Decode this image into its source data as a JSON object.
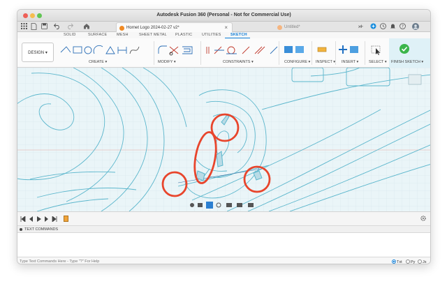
{
  "window": {
    "title": "Autodesk Fusion 360 (Personal - Not for Commercial Use)"
  },
  "tabs": [
    {
      "label": "Hornet Logo 2024-02-27 v2*",
      "active": true
    },
    {
      "label": "Untitled*",
      "active": false
    }
  ],
  "workspace_tabs": [
    "SOLID",
    "SURFACE",
    "MESH",
    "SHEET METAL",
    "PLASTIC",
    "UTILITIES",
    "SKETCH"
  ],
  "active_workspace_tab": "SKETCH",
  "toolbar": {
    "design_label": "DESIGN",
    "groups": {
      "create": "CREATE",
      "modify": "MODIFY",
      "constraints": "CONSTRAINTS",
      "configure": "CONFIGURE",
      "inspect": "INSPECT",
      "insert": "INSERT",
      "select": "SELECT",
      "finish": "FINISH SKETCH"
    },
    "caret": "▾"
  },
  "text_commands": {
    "header": "TEXT COMMANDS",
    "placeholder": "Type Text Commands Here - Type \"?\" For Help",
    "modes": [
      {
        "label": "Txt",
        "selected": true
      },
      {
        "label": "Py",
        "selected": false
      },
      {
        "label": "Js",
        "selected": false
      }
    ]
  },
  "colors": {
    "accent": "#0a7bd6",
    "sketch_line": "#5bb6cc",
    "highlight_circle": "#e8452c",
    "finish_green": "#3bb54a",
    "canvas_bg": "#eaf5f8"
  },
  "icons": {
    "app_grid": "grid-icon",
    "file": "file-icon",
    "save": "save-icon",
    "undo": "undo-icon",
    "redo": "redo-icon",
    "home": "home-icon",
    "close": "close-icon",
    "new_tab": "plus-icon",
    "extensions": "extensions-icon",
    "notifications": "bell-icon",
    "help": "help-icon",
    "account": "avatar",
    "settings": "gear-icon"
  }
}
